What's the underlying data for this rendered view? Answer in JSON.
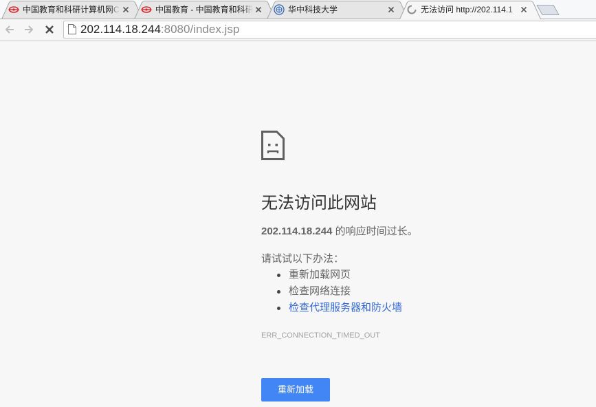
{
  "tabs": [
    {
      "title": "中国教育和科研计算机网C",
      "icon": "cernet-logo-icon",
      "active": false
    },
    {
      "title": "中国教育 - 中国教育和科研",
      "icon": "cernet-logo-icon",
      "active": false
    },
    {
      "title": "华中科技大学",
      "icon": "hust-logo-icon",
      "active": false
    },
    {
      "title": "无法访问 http://202.114.1",
      "icon": "loading-spinner-icon",
      "active": true
    }
  ],
  "toolbar": {
    "back_icon": "back-arrow-icon",
    "forward_icon": "forward-arrow-icon",
    "stop_icon": "stop-icon",
    "page_icon": "page-icon",
    "url_host": "202.114.18.244",
    "url_path": ":8080/index.jsp"
  },
  "error_page": {
    "icon": "sad-page-icon",
    "title": "无法访问此网站",
    "host": "202.114.18.244",
    "message": " 的响应时间过长。",
    "suggestions_heading": "请试试以下办法：",
    "suggestions": [
      {
        "text": "重新加载网页",
        "link": false
      },
      {
        "text": "检查网络连接",
        "link": false
      },
      {
        "text": "检查代理服务器和防火墙",
        "link": true
      }
    ],
    "error_code": "ERR_CONNECTION_TIMED_OUT",
    "reload_button": "重新加载"
  },
  "colors": {
    "page_background": "#f7f7f7",
    "accent": "#4285f4",
    "link": "#3367d6",
    "body_text": "#646464",
    "title_text": "#333333",
    "error_code_text": "#a2a2a2"
  }
}
